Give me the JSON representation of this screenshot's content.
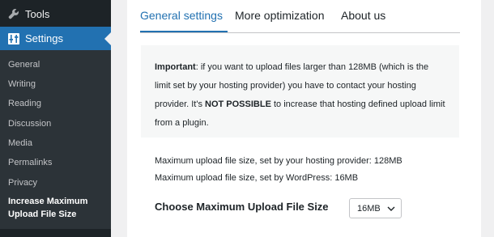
{
  "sidebar": {
    "tools_label": "Tools",
    "settings_label": "Settings",
    "submenu": [
      {
        "label": "General"
      },
      {
        "label": "Writing"
      },
      {
        "label": "Reading"
      },
      {
        "label": "Discussion"
      },
      {
        "label": "Media"
      },
      {
        "label": "Permalinks"
      },
      {
        "label": "Privacy"
      }
    ],
    "current_line1": "Increase Maximum",
    "current_line2": "Upload File Size",
    "tools_icon": "wrench-icon",
    "settings_icon": "settings-sliders-icon"
  },
  "tabs": [
    {
      "label": "General settings",
      "active": true
    },
    {
      "label": "More optimization",
      "active": false
    },
    {
      "label": "About us",
      "active": false
    }
  ],
  "notice": {
    "important_label": "Important",
    "text_part1": ": if you want to upload files larger than 128MB (which is the limit set by your hosting provider) you have to contact your hosting provider. It's ",
    "emphasis": "NOT POSSIBLE",
    "text_part2": " to increase that hosting defined upload limit from a plugin."
  },
  "info": {
    "hosting_limit_text": "Maximum upload file size, set by your hosting provider: 128MB",
    "wordpress_limit_text": "Maximum upload file size, set by WordPress: 16MB"
  },
  "choose": {
    "label": "Choose Maximum Upload File Size",
    "selected_value": "16MB"
  },
  "colors": {
    "accent": "#2271b1",
    "sidebar_bg": "#1d2327",
    "submenu_bg": "#2c3338",
    "notice_bg": "#f6f7f7"
  }
}
